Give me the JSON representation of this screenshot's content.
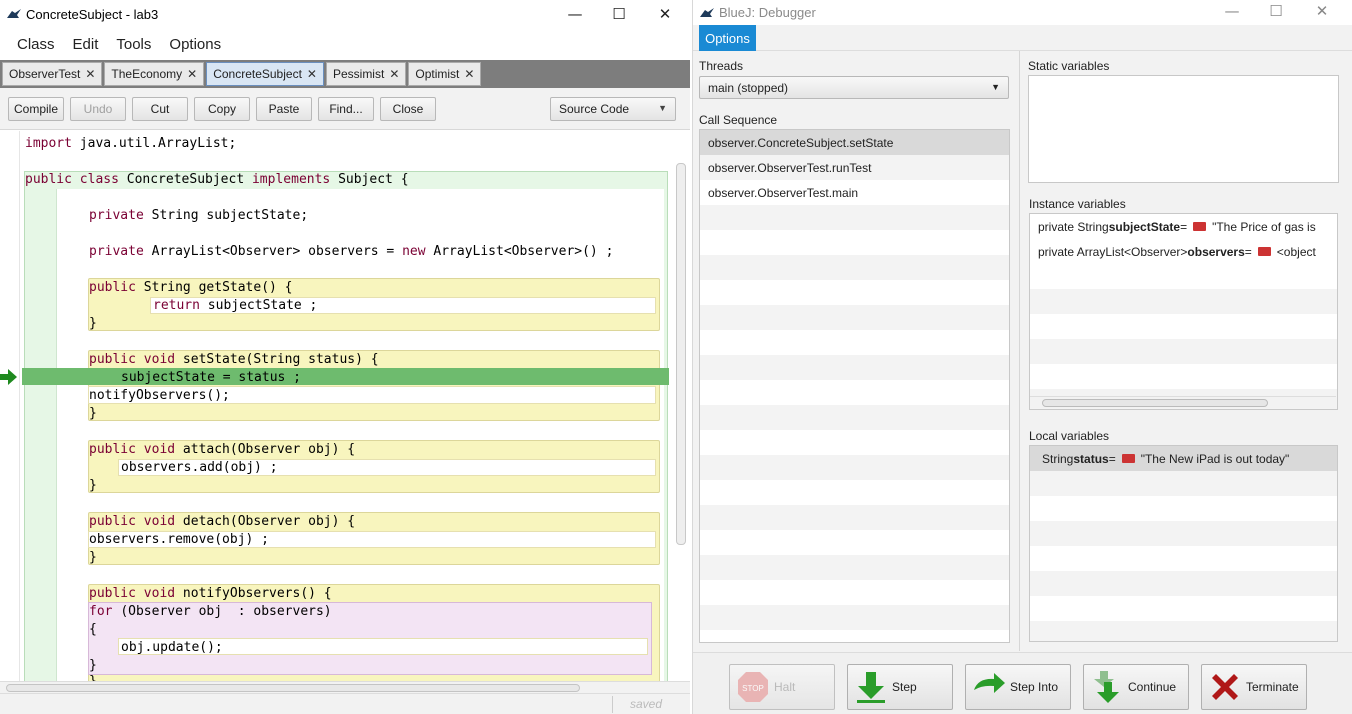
{
  "editor": {
    "title": "ConcreteSubject - lab3",
    "window_controls": {
      "minimize": "—",
      "maximize": "☐",
      "close": "✕"
    },
    "menu": [
      "Class",
      "Edit",
      "Tools",
      "Options"
    ],
    "tabs": [
      {
        "label": "ObserverTest",
        "close": "✕"
      },
      {
        "label": "TheEconomy",
        "close": "✕"
      },
      {
        "label": "ConcreteSubject",
        "close": "✕",
        "active": true
      },
      {
        "label": "Pessimist",
        "close": "✕"
      },
      {
        "label": "Optimist",
        "close": "✕"
      }
    ],
    "toolbar": {
      "compile": "Compile",
      "undo": "Undo",
      "cut": "Cut",
      "copy": "Copy",
      "paste": "Paste",
      "find": "Find...",
      "close": "Close",
      "view_select": "Source Code"
    },
    "code": {
      "l1": "import java.util.ArrayList;",
      "l2a": "public class ",
      "l2b": "ConcreteSubject ",
      "l2c": "implements ",
      "l2d": "Subject {",
      "l3a": "private ",
      "l3b": "String subjectState;",
      "l4a": "private ",
      "l4b": "ArrayList<Observer> observers = ",
      "l4c": "new ",
      "l4d": "ArrayList<Observer>() ;",
      "l5a": "public ",
      "l5b": "String getState() {",
      "l6a": "return ",
      "l6b": "subjectState ;",
      "l7": "}",
      "l8a": "public void ",
      "l8b": "setState(String status) {",
      "l9": "subjectState = status ;",
      "l10": "notifyObservers();",
      "l11": "}",
      "l12a": "public void ",
      "l12b": "attach(Observer obj) {",
      "l13": "observers.add(obj) ;",
      "l14": "}",
      "l15a": "public void ",
      "l15b": "detach(Observer obj) {",
      "l16": "observers.remove(obj) ;",
      "l17": "}",
      "l18a": "public void ",
      "l18b": "notifyObservers() {",
      "l19a": "for ",
      "l19b": "(Observer obj  : observers)",
      "l20": "{",
      "l21": "obj.update();",
      "l22": "}",
      "l23": "}"
    },
    "status": "saved",
    "colors": {
      "keyword": "#7a0033",
      "exec_line": "#6ebb6e",
      "class_bg": "#e6f7e6",
      "method_bg": "#f8f5be",
      "loop_bg": "#f3e4f4"
    }
  },
  "debugger": {
    "title": "BlueJ:  Debugger",
    "window_controls": {
      "minimize": "—",
      "maximize": "☐",
      "close": "✕"
    },
    "options_label": "Options",
    "threads_label": "Threads",
    "thread_selected": "main (stopped)",
    "call_sequence_label": "Call Sequence",
    "call_sequence": [
      "observer.ConcreteSubject.setState",
      "observer.ObserverTest.runTest",
      "observer.ObserverTest.main"
    ],
    "static_label": "Static variables",
    "instance_label": "Instance variables",
    "instance_vars": [
      {
        "prefix": "private  String ",
        "name": "subjectState",
        "eq": " = ",
        "value": "\"The Price of gas is"
      },
      {
        "prefix": "private  ArrayList<Observer> ",
        "name": "observers",
        "eq": " = ",
        "value": "<object"
      }
    ],
    "local_label": "Local variables",
    "local_vars": [
      {
        "prefix": "String ",
        "name": "status",
        "eq": " = ",
        "value": "\"The New iPad is out today\""
      }
    ],
    "buttons": {
      "halt": "Halt",
      "step": "Step",
      "step_into": "Step Into",
      "continue": "Continue",
      "terminate": "Terminate"
    },
    "accent": "#1a8ad4"
  }
}
